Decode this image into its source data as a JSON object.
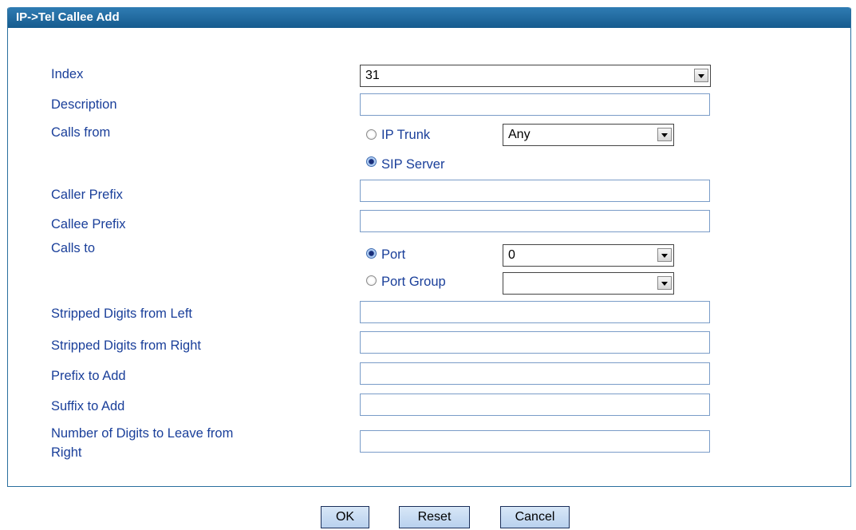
{
  "panel": {
    "title": "IP->Tel Callee Add"
  },
  "fields": {
    "index": {
      "label": "Index",
      "value": "31"
    },
    "description": {
      "label": "Description",
      "value": ""
    },
    "calls_from": {
      "label": "Calls from",
      "options": [
        {
          "label": "IP Trunk",
          "checked": false,
          "select_value": "Any"
        },
        {
          "label": "SIP Server",
          "checked": true
        }
      ]
    },
    "caller_prefix": {
      "label": "Caller Prefix",
      "value": ""
    },
    "callee_prefix": {
      "label": "Callee Prefix",
      "value": ""
    },
    "calls_to": {
      "label": "Calls to",
      "options": [
        {
          "label": "Port",
          "checked": true,
          "select_value": "0"
        },
        {
          "label": "Port Group",
          "checked": false,
          "select_value": ""
        }
      ]
    },
    "stripped_left": {
      "label": "Stripped Digits from Left",
      "value": ""
    },
    "stripped_right": {
      "label": "Stripped Digits from Right",
      "value": ""
    },
    "prefix_add": {
      "label": "Prefix to Add",
      "value": ""
    },
    "suffix_add": {
      "label": "Suffix to Add",
      "value": ""
    },
    "leave_right": {
      "label_line1": "Number of Digits to Leave from",
      "label_line2": "Right",
      "value": ""
    }
  },
  "buttons": {
    "ok": "OK",
    "reset": "Reset",
    "cancel": "Cancel"
  }
}
